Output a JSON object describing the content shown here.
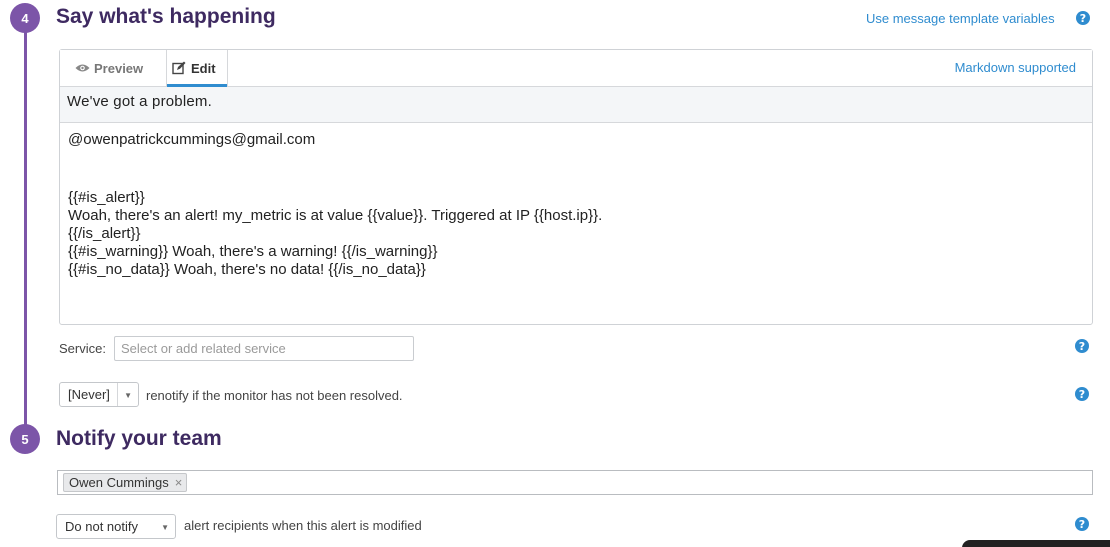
{
  "steps": {
    "say": {
      "number": "4",
      "title": "Say what's happening"
    },
    "notify": {
      "number": "5",
      "title": "Notify your team"
    }
  },
  "template_link": "Use message template variables",
  "editor": {
    "tabs": {
      "preview": "Preview",
      "edit": "Edit"
    },
    "active_tab": "Edit",
    "markdown_note": "Markdown supported",
    "subject": "We've got a problem.",
    "body_lines": [
      "@owenpatrickcummings@gmail.com",
      "",
      "",
      "{{#is_alert}}",
      "Woah, there's an alert! my_metric is at value {{value}}. Triggered at IP {{host.ip}}.",
      "{{/is_alert}}",
      "{{#is_warning}} Woah, there's a warning! {{/is_warning}}",
      "{{#is_no_data}} Woah, there's no data! {{/is_no_data}}"
    ]
  },
  "service": {
    "label": "Service:",
    "placeholder": "Select or add related service",
    "value": ""
  },
  "renotify": {
    "selected": "[Never]",
    "text": "renotify if the monitor has not been resolved."
  },
  "recipients": {
    "chips": [
      "Owen Cummings"
    ],
    "remove_glyph": "×"
  },
  "modify_notify": {
    "selected": "Do not notify",
    "text": "alert recipients when this alert is modified"
  },
  "help_glyph": "?",
  "colors": {
    "accent_purple": "#7c55a8",
    "title_purple": "#3e2a61",
    "link_blue": "#2f8ccf"
  }
}
